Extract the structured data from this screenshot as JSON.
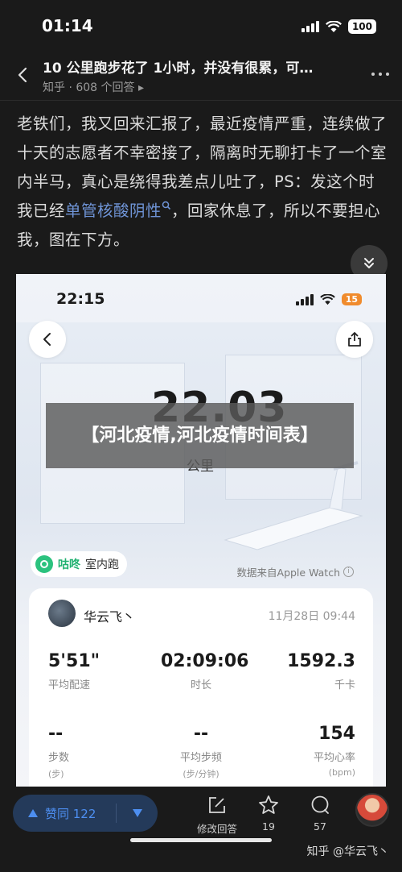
{
  "status_bar": {
    "time": "01:14",
    "battery": "100"
  },
  "header": {
    "title": "10 公里跑步花了 1小时，并没有很累，可…",
    "source": "知乎",
    "sep": "·",
    "answers": "608 个回答 ▸"
  },
  "answer": {
    "text_before": "老铁们，我又回来汇报了，最近疫情严重，连续做了十天的志愿者不幸密接了，隔离时无聊打卡了一个室内半马，真心是绕得我差点儿吐了，PS：发这个时我已经",
    "link_text": "单管核酸阴性",
    "text_after": "，回家休息了，所以不要担心我，图在下方。"
  },
  "embedded_screenshot": {
    "time": "22:15",
    "battery": "15",
    "distance": "22.03",
    "unit": "公里",
    "app_name": "咕咚",
    "activity_type": "室内跑",
    "data_source": "数据来自Apple Watch",
    "card": {
      "user": "华云飞丶",
      "date": "11月28日 09:44",
      "stats": [
        {
          "value": "5'51\"",
          "label": "平均配速",
          "sub": ""
        },
        {
          "value": "02:09:06",
          "label": "时长",
          "sub": ""
        },
        {
          "value": "1592.3",
          "label": "千卡",
          "sub": ""
        },
        {
          "value": "--",
          "label": "步数",
          "sub": "(步)"
        },
        {
          "value": "--",
          "label": "平均步频",
          "sub": "(步/分钟)"
        },
        {
          "value": "154",
          "label": "平均心率",
          "sub": "(bpm)"
        }
      ]
    }
  },
  "overlay_title": "【河北疫情,河北疫情时间表】",
  "bottom_bar": {
    "upvote_label": "赞同 122",
    "edit_label": "修改回答",
    "favorites_count": "19",
    "comments_count": "57",
    "watermark": "知乎 @华云飞丶"
  },
  "colors": {
    "link": "#6f94d6",
    "vote_bg": "#243a5a",
    "vote_fg": "#4d8ef0",
    "app_green": "#1fb170"
  }
}
